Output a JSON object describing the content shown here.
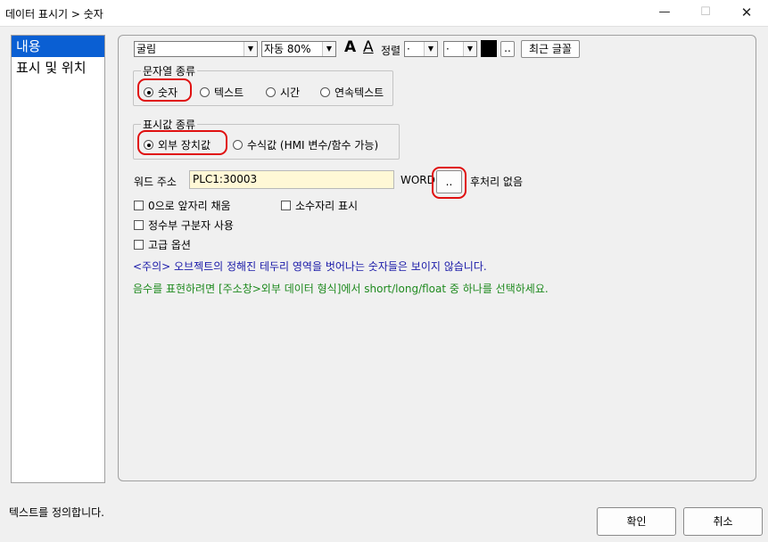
{
  "window": {
    "title": "데이터 표시기 > 숫자",
    "minimize": "—",
    "maximize": "☐",
    "close": "✕"
  },
  "sidebar": {
    "items": [
      {
        "label": "내용",
        "selected": true
      },
      {
        "label": "표시 및 위치",
        "selected": false
      }
    ]
  },
  "toolbar": {
    "font": "굴림",
    "size": "자동 80%",
    "font_color_glyph": "A",
    "outline_glyph": "A",
    "align_label": "정렬",
    "align_h": "·",
    "align_v": "·",
    "color_swatch": "#000000",
    "more_button": "..",
    "recent_font_button": "최근 글꼴"
  },
  "string_type": {
    "legend": "문자열 종류",
    "options": [
      "숫자",
      "텍스트",
      "시간",
      "연속텍스트"
    ],
    "selected": "숫자"
  },
  "value_type": {
    "legend": "표시값 종류",
    "options": [
      "외부 장치값",
      "수식값 (HMI 변수/함수 가능)"
    ],
    "selected": "외부 장치값"
  },
  "address": {
    "label": "워드 주소",
    "value": "PLC1:30003",
    "unit": "WORD",
    "browse_button": "..",
    "postprocess": "후처리 없음"
  },
  "options": {
    "leading_zero": "0으로 앞자리 채움",
    "show_decimal": "소수자리 표시",
    "thousand_sep": "정수부 구분자 사용",
    "advanced": "고급 옵션"
  },
  "notes": {
    "caution": "<주의> 오브젝트의 정해진 테두리 영역을 벗어나는 숫자들은 보이지 않습니다.",
    "negative": "음수를 표현하려면 [주소창>외부 데이터 형식]에서 short/long/float 중 하나를 선택하세요."
  },
  "colors": {
    "caution_text": "#1a1aa8",
    "negative_text": "#1f8a1f",
    "highlight": "#e01010",
    "address_bg": "#fff8d6",
    "selection": "#0a5fd3"
  },
  "status": {
    "text": "텍스트를 정의합니다.",
    "ok_button": "확인",
    "cancel_button": "취소"
  }
}
